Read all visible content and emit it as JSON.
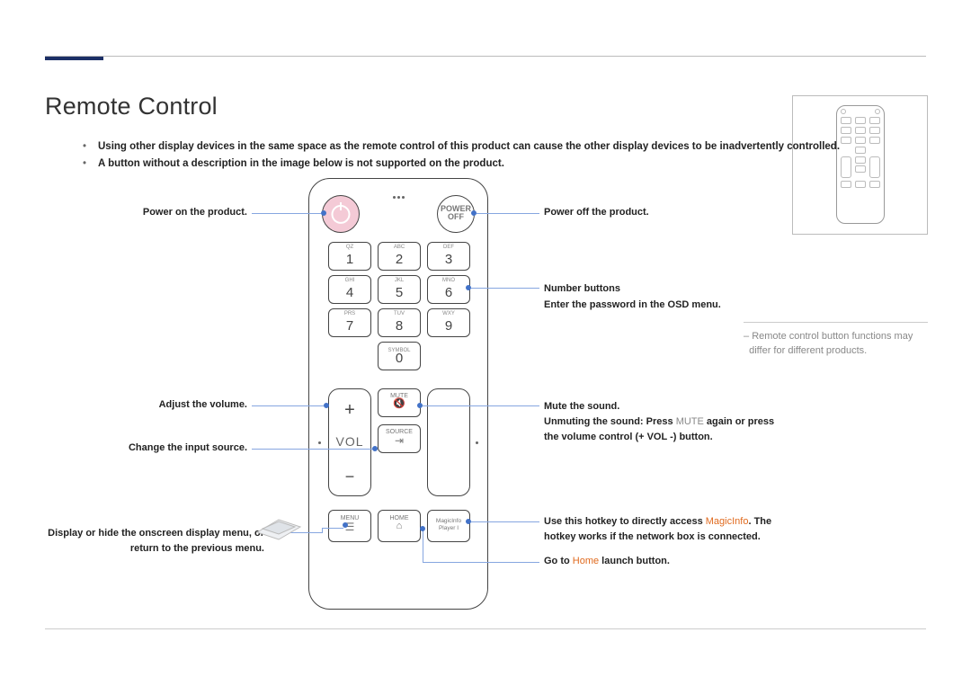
{
  "title": "Remote Control",
  "notes": [
    "Using other display devices in the same space as the remote control of this product can cause the other display devices to be inadvertently controlled.",
    "A button without a description in the image below is not supported on the product."
  ],
  "callouts": {
    "power_on": "Power on the product.",
    "power_off": "Power off the product.",
    "numbers_line1": "Number buttons",
    "numbers_line2": "Enter the password in the OSD menu.",
    "vol": "Adjust the volume.",
    "mute_line1": "Mute the sound.",
    "mute_line2_a": "Unmuting the sound: Press ",
    "mute_line2_b": "MUTE",
    "mute_line2_c": " again or press",
    "mute_line3": "the volume control (+ VOL -) button.",
    "source": "Change the input source.",
    "menu_line1": "Display or hide the onscreen display menu, or",
    "menu_line2": "return to the previous menu.",
    "magic_line1_a": "Use this hotkey to directly access ",
    "magic_line1_b": "MagicInfo",
    "magic_line1_c": ". The",
    "magic_line2": "hotkey works if the network box is connected.",
    "home_line_a": "Go to ",
    "home_line_b": "Home",
    "home_line_c": " launch button."
  },
  "remote": {
    "power_off_label": "POWER\nOFF",
    "keys": {
      "r1": [
        {
          "l": "QZ",
          "d": "1"
        },
        {
          "l": "ABC",
          "d": "2"
        },
        {
          "l": "DEF",
          "d": "3"
        }
      ],
      "r2": [
        {
          "l": "GHI",
          "d": "4"
        },
        {
          "l": "JKL",
          "d": "5"
        },
        {
          "l": "MNO",
          "d": "6"
        }
      ],
      "r3": [
        {
          "l": "PRS",
          "d": "7"
        },
        {
          "l": "TUV",
          "d": "8"
        },
        {
          "l": "WXY",
          "d": "9"
        }
      ],
      "r4": [
        {
          "l": "SYMBOL",
          "d": "0"
        }
      ]
    },
    "vol_label": "VOL",
    "mute_label": "MUTE",
    "source_label": "SOURCE",
    "menu_label": "MENU",
    "home_label": "HOME",
    "magic_label_1": "MagicInfo",
    "magic_label_2": "Player I"
  },
  "sidefoot": {
    "line1_a": "Remote control button functions may",
    "line1_b": "differ for different products."
  }
}
